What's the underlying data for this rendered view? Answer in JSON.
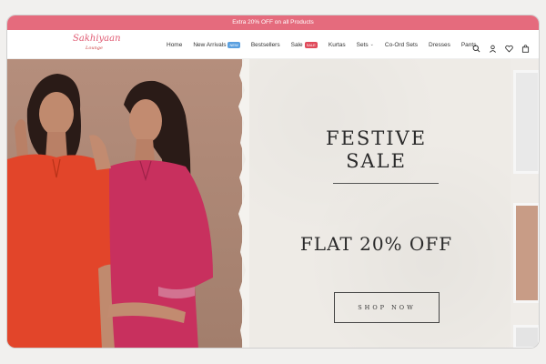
{
  "promo": {
    "text": "Extra 20% OFF on all Products"
  },
  "brand": {
    "name": "Sakhiyaan",
    "tagline": "Lounge"
  },
  "nav": {
    "items": [
      {
        "label": "Home"
      },
      {
        "label": "New Arrivals",
        "badge": "NEW"
      },
      {
        "label": "Bestsellers"
      },
      {
        "label": "Sale",
        "badge": "SALE"
      },
      {
        "label": "Kurtas"
      },
      {
        "label": "Sets",
        "dropdown": true
      },
      {
        "label": "Co-Ord Sets"
      },
      {
        "label": "Dresses"
      },
      {
        "label": "Pants"
      }
    ]
  },
  "header_icons": [
    "search-icon",
    "account-icon",
    "wishlist-icon",
    "cart-icon"
  ],
  "hero": {
    "headline_line1": "FESTIVE",
    "headline_line2": "SALE",
    "offer": "FLAT 20% OFF",
    "cta": "SHOP NOW"
  },
  "colors": {
    "promo_bar": "#e56b7d",
    "brand": "#e05a72",
    "kurta_orange": "#e2452a",
    "kurta_pink": "#c8305e",
    "paper": "#eeebe6"
  }
}
